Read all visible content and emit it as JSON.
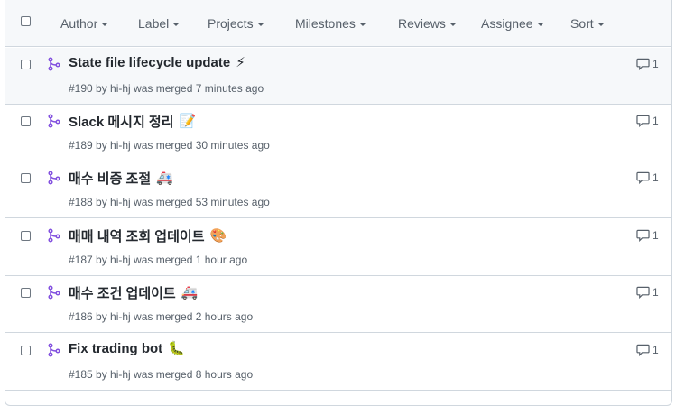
{
  "filters": [
    "Author",
    "Label",
    "Projects",
    "Milestones",
    "Reviews",
    "Assignee",
    "Sort"
  ],
  "pull_requests": [
    {
      "title": "State file lifecycle update",
      "emoji": "⚡",
      "emoji_name": "zap-emoji",
      "meta": "#190 by hi-hj was merged 7 minutes ago",
      "comments": "1"
    },
    {
      "title": "Slack 메시지 정리",
      "emoji": "📝",
      "emoji_name": "memo-emoji",
      "meta": "#189 by hi-hj was merged 30 minutes ago",
      "comments": "1"
    },
    {
      "title": "매수 비중 조절",
      "emoji": "🚑",
      "emoji_name": "ambulance-emoji",
      "meta": "#188 by hi-hj was merged 53 minutes ago",
      "comments": "1"
    },
    {
      "title": "매매 내역 조회 업데이트",
      "emoji": "🎨",
      "emoji_name": "palette-emoji",
      "meta": "#187 by hi-hj was merged 1 hour ago",
      "comments": "1"
    },
    {
      "title": "매수 조건 업데이트",
      "emoji": "🚑",
      "emoji_name": "ambulance-emoji",
      "meta": "#186 by hi-hj was merged 2 hours ago",
      "comments": "1"
    },
    {
      "title": "Fix trading bot",
      "emoji": "🐛",
      "emoji_name": "bug-emoji",
      "meta": "#185 by hi-hj was merged 8 hours ago",
      "comments": "1"
    }
  ],
  "colors": {
    "merged": "#8250df",
    "muted": "#57606a",
    "border": "#d0d7de",
    "header_bg": "#f6f8fa"
  }
}
